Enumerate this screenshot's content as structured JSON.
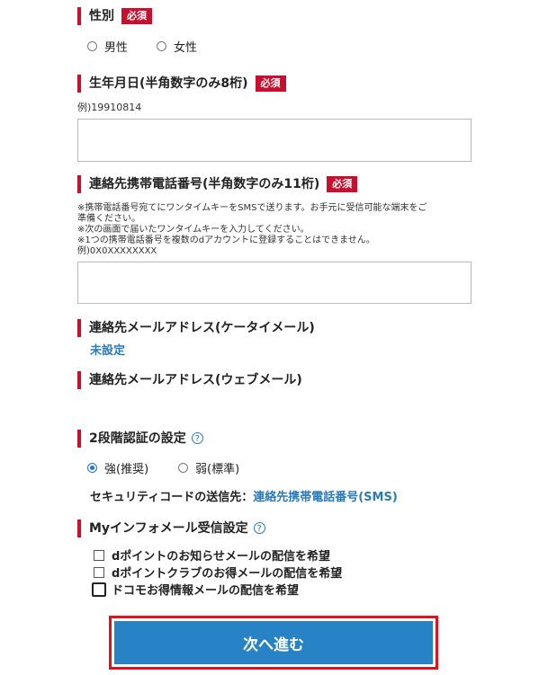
{
  "colors": {
    "accent": "#c8102e",
    "link": "#2a7ab8",
    "button": "#2783c5",
    "highlight": "#e0121e"
  },
  "gender": {
    "label": "性別",
    "badge": "必須",
    "options": [
      "男性",
      "女性"
    ]
  },
  "birthdate": {
    "label": "生年月日(半角数字のみ8桁)",
    "badge": "必須",
    "example": "例)19910814",
    "value": ""
  },
  "phone": {
    "label": "連絡先携帯電話番号(半角数字のみ11桁)",
    "badge": "必須",
    "notes": [
      "※携帯電話番号宛てにワンタイムキーをSMSで送ります。お手元に受信可能な端末をご",
      "準備ください。",
      "※次の画面で届いたワンタイムキーを入力してください。",
      "※1つの携帯電話番号を複数のdアカウントに登録することはできません。",
      "例)0X0XXXXXXXX"
    ],
    "value": ""
  },
  "mobile_mail": {
    "label": "連絡先メールアドレス(ケータイメール)",
    "value": "未設定"
  },
  "web_mail": {
    "label": "連絡先メールアドレス(ウェブメール)"
  },
  "two_step": {
    "label": "2段階認証の設定",
    "help_icon": "help-icon",
    "options": [
      "強(推奨)",
      "弱(標準)"
    ],
    "selected": "強(推奨)",
    "dest_label": "セキュリティコードの送信先：",
    "dest_value": "連絡先携帯電話番号(SMS)"
  },
  "info_mail": {
    "label": "Myインフォメール受信設定",
    "help_icon": "help-icon",
    "options": [
      "dポイントのお知らせメールの配信を希望",
      "dポイントクラブのお得メールの配信を希望",
      "ドコモお得情報メールの配信を希望"
    ]
  },
  "next_button": {
    "label": "次へ進む"
  }
}
